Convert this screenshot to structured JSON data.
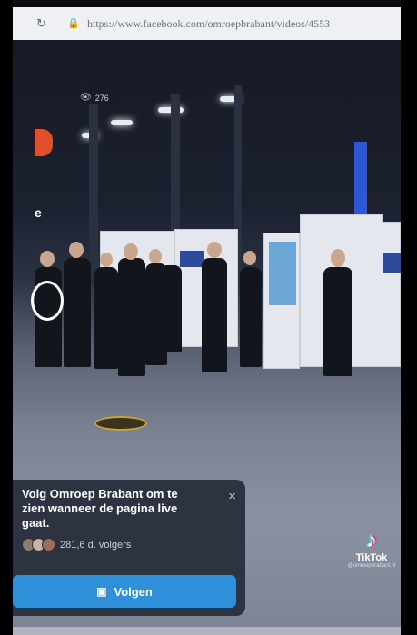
{
  "browser": {
    "url": "https://www.facebook.com/omroepbrabant/videos/4553"
  },
  "video": {
    "view_count": "276",
    "side_text": "e"
  },
  "popup": {
    "message": "Volg Omroep Brabant om te zien wanneer de pagina live gaat.",
    "close_symbol": "×",
    "followers": "281,6 d. volgers",
    "follow_label": "Volgen"
  },
  "watermark": {
    "brand": "TikTok",
    "handle": "@omroepbrabant.nl"
  },
  "colors": {
    "follow_button": "#2f8fd8",
    "popup_bg": "#262c3a",
    "highlight_circle": "#ffffff"
  }
}
